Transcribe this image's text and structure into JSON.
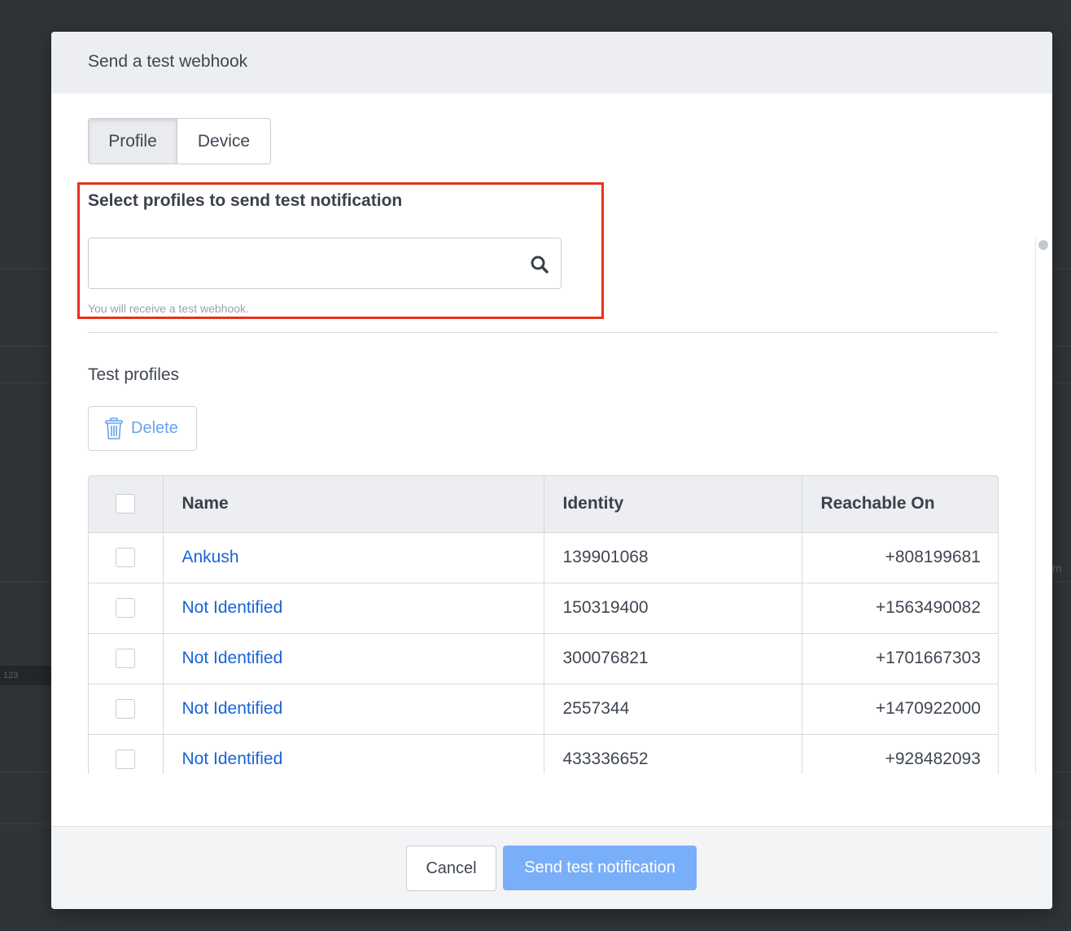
{
  "background": {
    "badge_text": "123",
    "right_fragment": "m"
  },
  "modal": {
    "title": "Send a test webhook",
    "tabs": [
      {
        "label": "Profile",
        "active": true
      },
      {
        "label": "Device",
        "active": false
      }
    ],
    "select_section": {
      "title": "Select profiles to send test notification",
      "search_value": "",
      "search_placeholder": "",
      "hint": "You will receive a test webhook."
    },
    "test_profiles": {
      "title": "Test profiles",
      "delete_label": "Delete",
      "columns": [
        "Name",
        "Identity",
        "Reachable On"
      ],
      "rows": [
        {
          "name": "Ankush",
          "identity": "139901068",
          "reachable_on": "+808199681"
        },
        {
          "name": "Not Identified",
          "identity": "150319400",
          "reachable_on": "+1563490082"
        },
        {
          "name": "Not Identified",
          "identity": "300076821",
          "reachable_on": "+1701667303"
        },
        {
          "name": "Not Identified",
          "identity": "2557344",
          "reachable_on": "+1470922000"
        },
        {
          "name": "Not Identified",
          "identity": "433336652",
          "reachable_on": "+928482093"
        }
      ]
    },
    "footer": {
      "cancel_label": "Cancel",
      "send_label": "Send test notification"
    }
  },
  "colors": {
    "accent_link": "#1a63d6",
    "primary_button": "#79aef8",
    "highlight_border": "#e8321a",
    "header_bg": "#eceef1"
  },
  "icons": {
    "search": "search-icon",
    "delete": "trash-icon"
  }
}
